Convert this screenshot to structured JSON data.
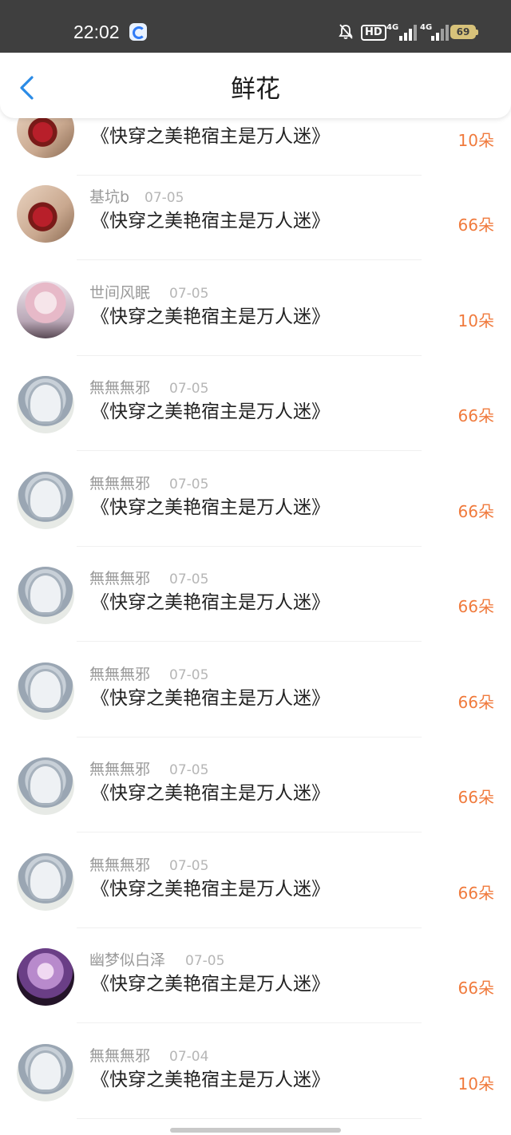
{
  "status_bar": {
    "time": "22:02",
    "hd": "HD",
    "signal1_label": "4G",
    "signal2_label": "4G",
    "battery": "69"
  },
  "header": {
    "title": "鲜花"
  },
  "rows": [
    {
      "name": "",
      "date": "",
      "book": "《快穿之美艳宿主是万人迷》",
      "amount": "10朵",
      "avatar": "flower"
    },
    {
      "name": "基坑b",
      "date": "07-05",
      "book": "《快穿之美艳宿主是万人迷》",
      "amount": "66朵",
      "avatar": "flower"
    },
    {
      "name": "世间风眠",
      "date": "07-05",
      "book": "《快穿之美艳宿主是万人迷》",
      "amount": "10朵",
      "avatar": "pink"
    },
    {
      "name": "無無無邪",
      "date": "07-05",
      "book": "《快穿之美艳宿主是万人迷》",
      "amount": "66朵",
      "avatar": "anime"
    },
    {
      "name": "無無無邪",
      "date": "07-05",
      "book": "《快穿之美艳宿主是万人迷》",
      "amount": "66朵",
      "avatar": "anime"
    },
    {
      "name": "無無無邪",
      "date": "07-05",
      "book": "《快穿之美艳宿主是万人迷》",
      "amount": "66朵",
      "avatar": "anime"
    },
    {
      "name": "無無無邪",
      "date": "07-05",
      "book": "《快穿之美艳宿主是万人迷》",
      "amount": "66朵",
      "avatar": "anime"
    },
    {
      "name": "無無無邪",
      "date": "07-05",
      "book": "《快穿之美艳宿主是万人迷》",
      "amount": "66朵",
      "avatar": "anime"
    },
    {
      "name": "無無無邪",
      "date": "07-05",
      "book": "《快穿之美艳宿主是万人迷》",
      "amount": "66朵",
      "avatar": "anime"
    },
    {
      "name": "幽梦似白泽",
      "date": "07-05",
      "book": "《快穿之美艳宿主是万人迷》",
      "amount": "66朵",
      "avatar": "purple"
    },
    {
      "name": "無無無邪",
      "date": "07-04",
      "book": "《快穿之美艳宿主是万人迷》",
      "amount": "10朵",
      "avatar": "anime"
    }
  ],
  "colors": {
    "accent_amount": "#f07a3c",
    "back_arrow": "#2a8be6",
    "status_bar": "#3f3f3f"
  },
  "icons": {
    "back": "chevron-left-icon",
    "mute": "bell-off-icon"
  }
}
